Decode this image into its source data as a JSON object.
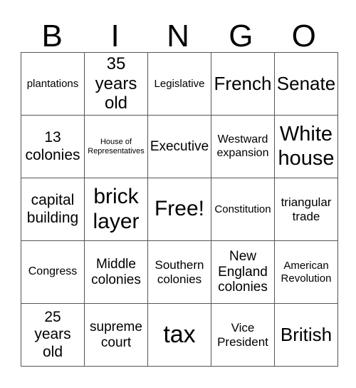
{
  "header": {
    "letters": [
      "B",
      "I",
      "N",
      "G",
      "O"
    ]
  },
  "board": {
    "rows": [
      [
        "plantations",
        "35\nyears\nold",
        "Legislative",
        "French",
        "Senate"
      ],
      [
        "13\ncolonies",
        "House of\nRepresentatives",
        "Executive",
        "Westward\nexpansion",
        "White\nhouse"
      ],
      [
        "capital\nbuilding",
        "brick\nlayer",
        "Free!",
        "Constitution",
        "triangular\ntrade"
      ],
      [
        "Congress",
        "Middle\ncolonies",
        "Southern\ncolonies",
        "New\nEngland\ncolonies",
        "American\nRevolution"
      ],
      [
        "25\nyears\nold",
        "supreme\ncourt",
        "tax",
        "Vice\nPresident",
        "British"
      ]
    ],
    "free_space": "Free!"
  }
}
